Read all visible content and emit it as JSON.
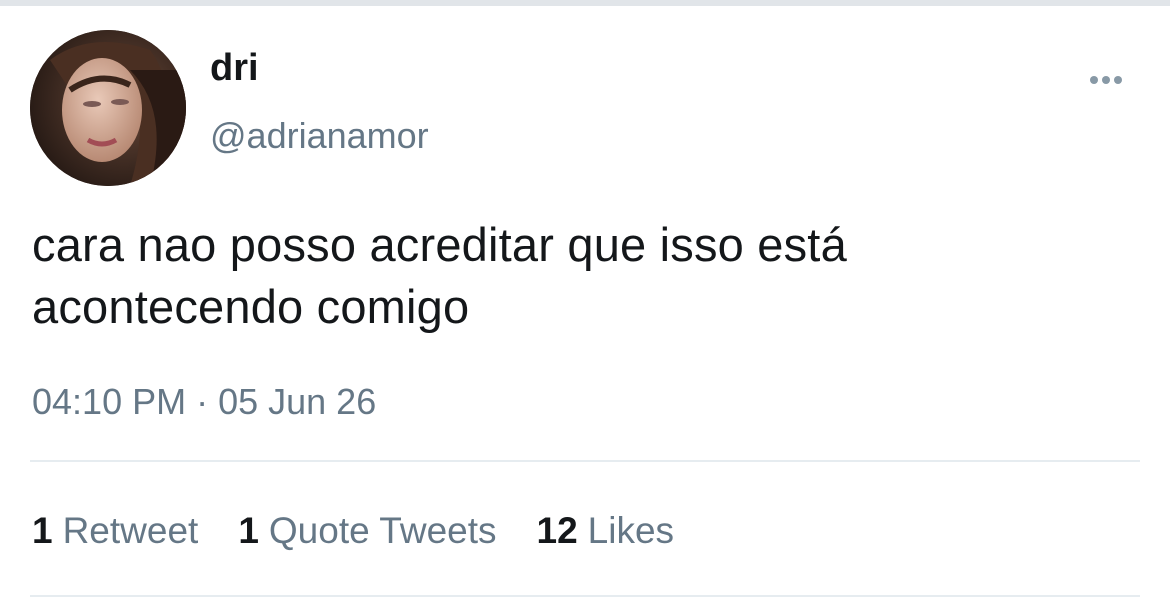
{
  "tweet": {
    "display_name": "dri",
    "handle": "@adrianamor",
    "text_line1": "cara nao posso acreditar que isso está",
    "text_line2": "acontecendo comigo",
    "timestamp": "04:10 PM · 05 Jun 26"
  },
  "stats": [
    {
      "count": "1",
      "label": "Retweet"
    },
    {
      "count": "1",
      "label": "Quote Tweets"
    },
    {
      "count": "12",
      "label": "Likes"
    }
  ],
  "icons": {
    "more": "more-horizontal-icon"
  },
  "colors": {
    "primary_text": "#14171a",
    "secondary_text": "#657786",
    "divider": "#e6ecf0"
  }
}
